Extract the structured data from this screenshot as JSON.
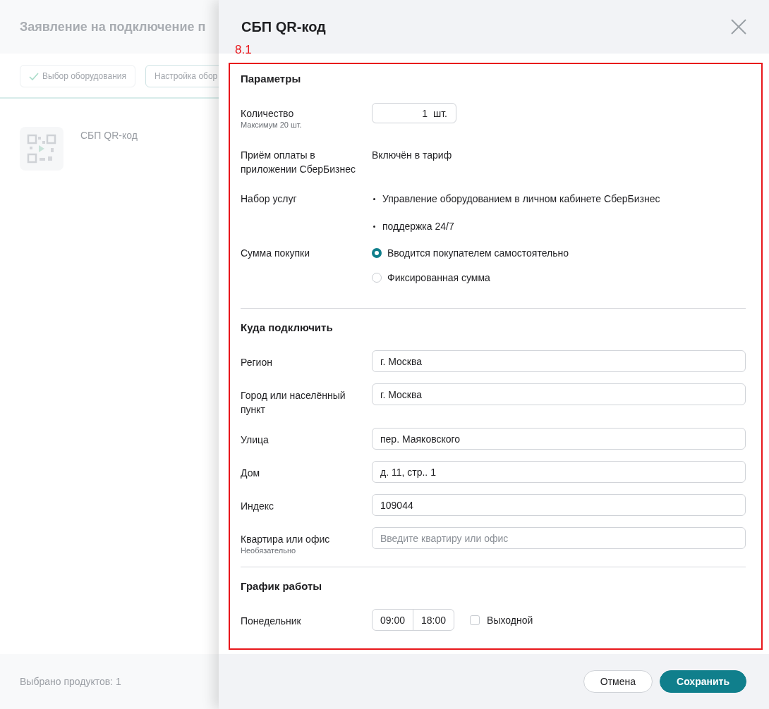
{
  "background": {
    "title": "Заявление на подключение п",
    "steps": [
      {
        "label": "Выбор оборудования",
        "done": true
      },
      {
        "label": "Настройка обор",
        "done": false
      }
    ],
    "product": {
      "name": "СБП QR-код"
    },
    "footer_text": "Выбрано продуктов: 1"
  },
  "drawer": {
    "title": "СБП QR-код",
    "annotation": "8.1",
    "sections": [
      {
        "title": "Параметры",
        "rows": [
          {
            "kind": "quantity",
            "label": "Количество",
            "hint": "Максимум 20 шт.",
            "value": "1",
            "unit": "шт."
          },
          {
            "kind": "text",
            "label": "Приём оплаты в приложении СберБизнес",
            "value": "Включён в тариф"
          },
          {
            "kind": "list",
            "label": "Набор услуг",
            "items": [
              "Управление оборудованием в личном кабинете СберБизнес",
              "поддержка 24/7"
            ]
          },
          {
            "kind": "radio",
            "label": "Сумма покупки",
            "options": [
              {
                "label": "Вводится покупателем самостоятельно",
                "selected": true
              },
              {
                "label": "Фиксированная сумма",
                "selected": false
              }
            ]
          }
        ]
      },
      {
        "title": "Куда подключить",
        "rows": [
          {
            "kind": "input",
            "label": "Регион",
            "value": "г. Москва"
          },
          {
            "kind": "input",
            "label": "Город или населённый пункт",
            "value": "г. Москва"
          },
          {
            "kind": "input",
            "label": "Улица",
            "value": "пер. Маяковского"
          },
          {
            "kind": "input",
            "label": "Дом",
            "value": "д. 11, стр.. 1"
          },
          {
            "kind": "input",
            "label": "Индекс",
            "value": "109044"
          },
          {
            "kind": "input",
            "label": "Квартира или офис",
            "hint": "Необязательно",
            "placeholder": "Введите квартиру или офис"
          }
        ]
      },
      {
        "title": "График работы",
        "rows": [
          {
            "kind": "schedule",
            "label": "Понедельник",
            "from": "09:00",
            "to": "18:00",
            "day_off": false,
            "day_off_label": "Выходной"
          }
        ]
      }
    ]
  },
  "buttons": [
    {
      "label": "Отмена",
      "kind": "secondary"
    },
    {
      "label": "Сохранить",
      "kind": "primary"
    }
  ]
}
